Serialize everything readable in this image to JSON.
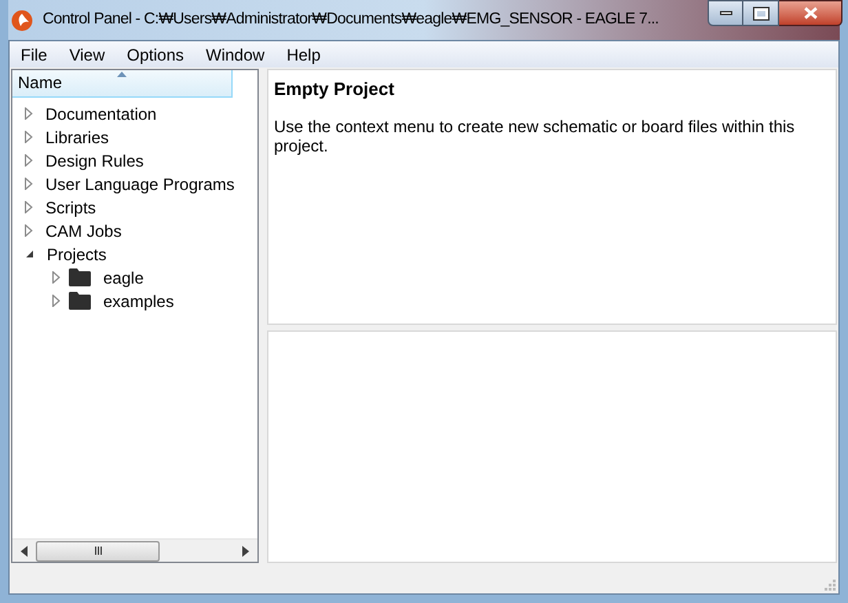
{
  "window": {
    "title": "Control Panel - C:₩Users₩Administrator₩Documents₩eagle₩EMG_SENSOR - EAGLE 7..."
  },
  "menu": [
    "File",
    "View",
    "Options",
    "Window",
    "Help"
  ],
  "tree": {
    "column": "Name",
    "items": [
      {
        "label": "Documentation",
        "expanded": false
      },
      {
        "label": "Libraries",
        "expanded": false
      },
      {
        "label": "Design Rules",
        "expanded": false
      },
      {
        "label": "User Language Programs",
        "expanded": false
      },
      {
        "label": "Scripts",
        "expanded": false
      },
      {
        "label": "CAM Jobs",
        "expanded": false
      },
      {
        "label": "Projects",
        "expanded": true,
        "children": [
          {
            "label": "eagle",
            "expanded": false
          },
          {
            "label": "examples",
            "expanded": false
          }
        ]
      }
    ]
  },
  "info": {
    "title": "Empty Project",
    "text": "Use the context menu to create new schematic or board files within this project."
  }
}
